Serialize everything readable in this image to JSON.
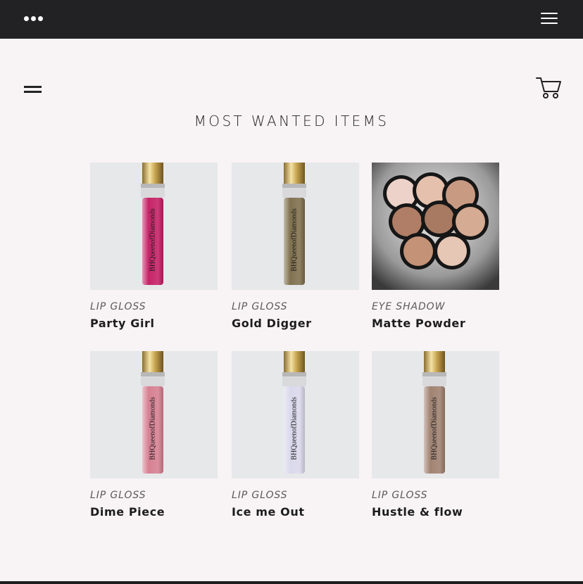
{
  "topbar": {
    "more_icon": "ellipsis-icon",
    "menu_icon": "hamburger-icon"
  },
  "header": {
    "menu_icon": "hamburger-icon",
    "cart_icon": "cart-icon"
  },
  "section": {
    "title": "MOST WANTED ITEMS"
  },
  "colors": {
    "background": "#f8f3f4",
    "topbar": "#222124",
    "text": "#1d1d1d",
    "category": "#5b5b5b"
  },
  "products": [
    {
      "category": "LIP GLOSS",
      "name": "Party Girl",
      "image": "tube",
      "liquid": "#c2185f",
      "brand_text": "BHQueenofDiamonds"
    },
    {
      "category": "LIP GLOSS",
      "name": "Gold Digger",
      "image": "tube",
      "liquid": "#7a6a46",
      "brand_text": "BHQueenofDiamonds"
    },
    {
      "category": "EYE SHADOW",
      "name": "Matte Powder",
      "image": "compacts",
      "shades": [
        "#ecd2c8",
        "#e4c0ad",
        "#c99a82",
        "#b07e66",
        "#a87a62",
        "#d5ab93",
        "#c49277",
        "#e6c6b4"
      ]
    },
    {
      "category": "LIP GLOSS",
      "name": "Dime Piece",
      "image": "tube",
      "liquid": "#d47a8c",
      "brand_text": "BHQueenofDiamonds"
    },
    {
      "category": "LIP GLOSS",
      "name": "Ice me Out",
      "image": "tube",
      "liquid": "#d8d6ea",
      "brand_text": "BHQueenofDiamonds"
    },
    {
      "category": "LIP GLOSS",
      "name": "Hustle & flow",
      "image": "tube",
      "liquid": "#9c7c6a",
      "brand_text": "BHQueenofDiamonds"
    }
  ]
}
